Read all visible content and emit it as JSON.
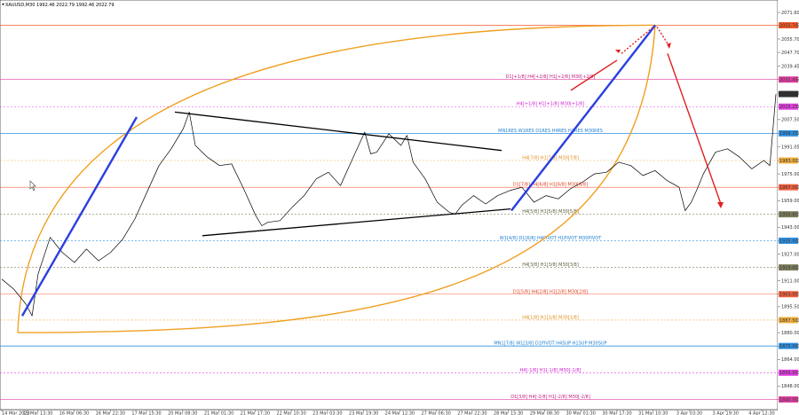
{
  "header": {
    "symbol_line": "XAUUSD,M30  1992.46 2022.79 1992.46 2022.79"
  },
  "chart_data": {
    "type": "line",
    "title": "XAUUSD,M30",
    "ylim": [
      1836,
      2078
    ],
    "y_ticks": [
      "2071.60",
      "2063.95",
      "2055.70",
      "2047.70",
      "2039.45",
      "2031.45",
      "2023.25",
      "2015.25",
      "2007.50",
      "1999.25",
      "1991.05",
      "1983.00",
      "1975.00",
      "1967.00",
      "1959.00",
      "1950.80",
      "1943.00",
      "1935.00",
      "1927.00",
      "1919.00",
      "1911.00",
      "1903.00",
      "1895.50",
      "1887.50",
      "1880.00",
      "1872.00",
      "1864.00",
      "1856.00",
      "1848.00",
      "1840.00"
    ],
    "x_ticks": [
      "14 Mar 2023",
      "15 Mar 13:30",
      "16 Mar 06:30",
      "16 Mar 22:30",
      "17 Mar 15:30",
      "20 Mar 08:30",
      "21 Mar 01:30",
      "21 Mar 17:30",
      "22 Mar 10:30",
      "23 Mar 03:30",
      "23 Mar 19:30",
      "24 Mar 12:30",
      "27 Mar 06:30",
      "27 Mar 22:30",
      "28 Mar 15:30",
      "29 Mar 08:30",
      "30 Mar 01:30",
      "30 Mar 17:30",
      "31 Mar 10:30",
      "3 Apr 03:30",
      "3 Apr 19:30",
      "4 Apr 12:30"
    ],
    "price_series": {
      "name": "XAUUSD",
      "x": [
        0,
        10,
        20,
        25,
        30,
        40,
        50,
        60,
        70,
        80,
        90,
        100,
        110,
        120,
        130,
        140,
        150,
        155,
        160,
        170,
        180,
        190,
        200,
        210,
        215,
        220,
        230,
        240,
        250,
        260,
        270,
        280,
        290,
        300,
        305,
        310,
        320,
        330,
        335,
        340,
        350,
        360,
        370,
        375,
        380,
        390,
        400,
        410,
        420,
        430,
        440,
        450,
        460,
        470,
        480,
        490,
        500,
        510,
        520,
        530,
        540,
        550,
        560,
        565,
        570,
        575,
        580,
        590,
        600,
        610,
        620,
        630,
        635,
        640
      ],
      "y": [
        1912,
        1906,
        1897,
        1890,
        1915,
        1937,
        1928,
        1922,
        1930,
        1923,
        1928,
        1936,
        1948,
        1964,
        1980,
        1990,
        2002,
        2012,
        1992,
        1985,
        1980,
        1981,
        1966,
        1950,
        1944,
        1946,
        1947,
        1955,
        1962,
        1972,
        1976,
        1968,
        1984,
        2000,
        1987,
        1988,
        1999,
        1992,
        1998,
        1982,
        1972,
        1958,
        1952,
        1951,
        1956,
        1962,
        1957,
        1962,
        1965,
        1967,
        1958,
        1962,
        1960,
        1966,
        1970,
        1975,
        1976,
        1982,
        1980,
        1974,
        1977,
        1971,
        1967,
        1953,
        1958,
        1966,
        1975,
        1988,
        1990,
        1985,
        1978,
        1983,
        1980,
        2022.79
      ]
    },
    "level_labels": {
      "l2055": "2055.70",
      "l2031": "2031.45",
      "l2015": "2015.25",
      "l1999": "1999.25",
      "l1983": "1983.00",
      "l1967": "1967.00",
      "l1951": "1950.80",
      "l1935": "1935.00",
      "l1919": "1919.00",
      "l1903": "1903.00",
      "l1887": "1887.50",
      "l1872": "1872.00",
      "l1856": "1856.00",
      "l1840": "1840.00",
      "current": "2022.79"
    },
    "level_texts": {
      "t2031": "D1[+1/8] H4[+2/8] H1[+2/8] M30[+2/8]",
      "t2015": "H4[+1/8] H1[+1/8] M30[+1/8]",
      "t1999": "MN1RES W1RES D1RES H4RES H1RES M30RES",
      "t1983": "H4[7/8] H1[7/8] M30[7/8]",
      "t1967": "D1[7/8] H4[6/8] H1[6/8] M30[6/8]",
      "t1951": "H4[5/8] H1[5/8] M30[5/8]",
      "t1935": "W1[4/8] D1[6/8] H4PIVOT H1PIVOT M30PIVOT",
      "t1919": "H4[3/8] H1[3/8] M30[3/8]",
      "t1903": "D1[5/8] H4[2/8] H1[2/8] M30[2/8]",
      "t1887": "H4[1/8] H1[1/8] M30[1/8]",
      "t1872": "MN1[7/8] W1[3/8] D1PIVOT H4SUP H1SUP M30SUP",
      "t1856": "H4[-1/8] H1[-1/8] M30[-1/8]",
      "t1840": "D1[3/8] H4[-2/8] H1[-2/8] M30[-2/8]"
    },
    "grid": false,
    "colors": {
      "price": "#000000",
      "blue_trend": "#2a40e0",
      "triangle": "#000000",
      "curve": "#f0a020",
      "projection": "#e02020"
    }
  }
}
